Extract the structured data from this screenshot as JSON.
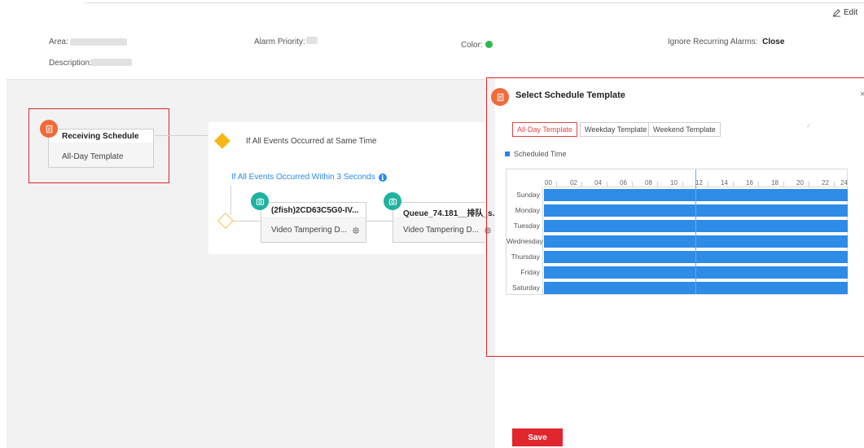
{
  "header": {
    "edit_label": "Edit"
  },
  "info": {
    "area_label": "Area:",
    "priority_label": "Alarm Priority:",
    "color_label": "Color:",
    "color_value": "#2db84c",
    "ignore_label": "Ignore Recurring Alarms:",
    "ignore_value": "Close",
    "description_label": "Description:"
  },
  "flow": {
    "schedule_title": "Receiving Schedule",
    "schedule_sub": "All-Day Template",
    "rule_text": "If All Events Occurred at Same Time",
    "rule_link": "If All Events Occurred Within 3 Seconds",
    "cameras": [
      {
        "title": "(2fish)2CD63C5G0-IV...",
        "event": "Video Tampering D..."
      },
      {
        "title": "Queue_74.181__排队_s...",
        "event": "Video Tampering D..."
      }
    ]
  },
  "schedule_panel": {
    "title": "Select Schedule Template",
    "templates": [
      "All-Day Template",
      "Weekday Template",
      "Weekend Template"
    ],
    "active_template": "All-Day Template",
    "legend": "Scheduled Time",
    "hours": [
      "00",
      "02",
      "04",
      "06",
      "08",
      "10",
      "12",
      "14",
      "16",
      "18",
      "20",
      "22",
      "24"
    ],
    "days": [
      "Sunday",
      "Monday",
      "Tuesday",
      "Wednesday",
      "Thursday",
      "Friday",
      "Saturday"
    ]
  },
  "footer": {
    "save_label": "Save"
  }
}
